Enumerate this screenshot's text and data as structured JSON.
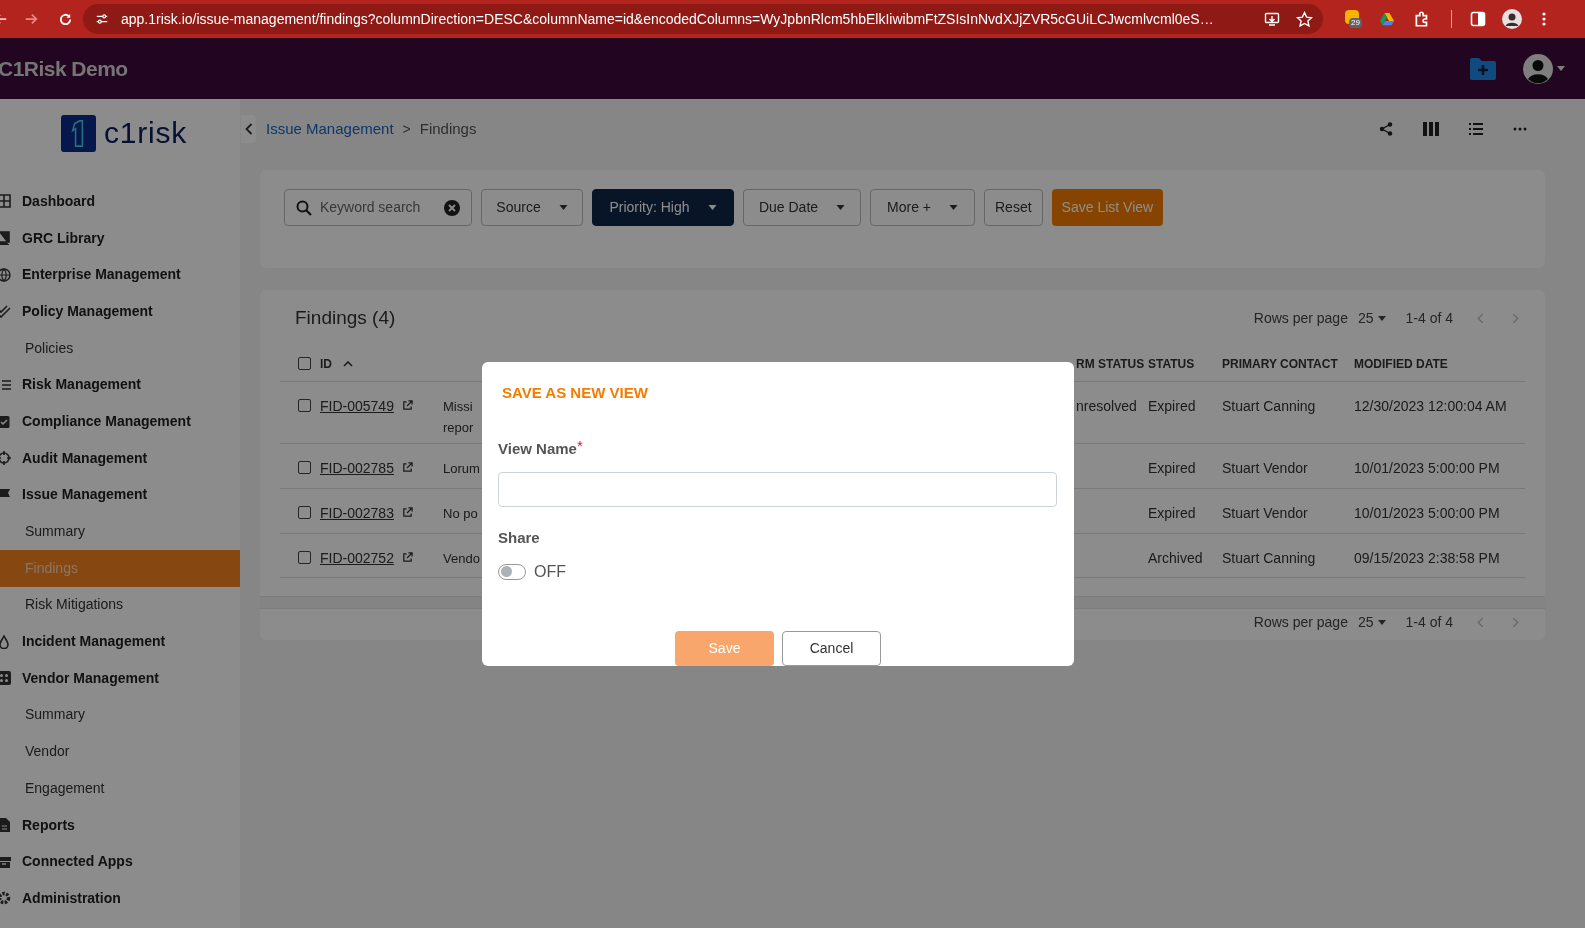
{
  "browser": {
    "url": "app.1risk.io/issue-management/findings?columnDirection=DESC&columnName=id&encodedColumns=WyJpbnRlcm5hbElkIiwibmFtZSIsInNvdXJjZVR5cGUiLCJwcmlvcml0eS…",
    "extension_badge": "29"
  },
  "app_header": {
    "title": "C1Risk Demo"
  },
  "sidebar": {
    "logo_text": "c1risk",
    "items": [
      {
        "label": "Dashboard",
        "kind": "section",
        "selected": false
      },
      {
        "label": "GRC Library",
        "kind": "section",
        "selected": false
      },
      {
        "label": "Enterprise Management",
        "kind": "section",
        "selected": false
      },
      {
        "label": "Policy Management",
        "kind": "section",
        "selected": false
      },
      {
        "label": "Policies",
        "kind": "page",
        "selected": false
      },
      {
        "label": "Risk Management",
        "kind": "section",
        "selected": false
      },
      {
        "label": "Compliance Management",
        "kind": "section",
        "selected": false
      },
      {
        "label": "Audit Management",
        "kind": "section",
        "selected": false
      },
      {
        "label": "Issue Management",
        "kind": "section",
        "selected": false
      },
      {
        "label": "Summary",
        "kind": "page",
        "selected": false
      },
      {
        "label": "Findings",
        "kind": "page",
        "selected": true
      },
      {
        "label": "Risk Mitigations",
        "kind": "page",
        "selected": false
      },
      {
        "label": "Incident Management",
        "kind": "section",
        "selected": false
      },
      {
        "label": "Vendor Management",
        "kind": "section",
        "selected": false
      },
      {
        "label": "Summary",
        "kind": "page",
        "selected": false
      },
      {
        "label": "Vendor",
        "kind": "page",
        "selected": false
      },
      {
        "label": "Engagement",
        "kind": "page",
        "selected": false
      },
      {
        "label": "Reports",
        "kind": "section",
        "selected": false
      },
      {
        "label": "Connected Apps",
        "kind": "section",
        "selected": false
      },
      {
        "label": "Administration",
        "kind": "section",
        "selected": false
      }
    ]
  },
  "breadcrumb": {
    "separator": ">",
    "items": [
      {
        "label": "Issue Management",
        "kind": "link"
      },
      {
        "label": "Findings",
        "kind": "current"
      }
    ]
  },
  "filters": {
    "search": {
      "placeholder": "Keyword search"
    },
    "dropdowns": [
      {
        "label": "Source",
        "active": false
      },
      {
        "label": "Priority: High",
        "active": true
      },
      {
        "label": "Due Date",
        "active": false
      },
      {
        "label": "More +",
        "active": false
      }
    ],
    "reset": "Reset",
    "save_view": "Save List View"
  },
  "findings": {
    "title": "Findings (4)",
    "pagination_top": {
      "rows_label": "Rows per page",
      "rows": "25",
      "range": "1-4 of 4"
    },
    "header_checked": false,
    "columns": [
      {
        "label": "ID",
        "sorted": true
      },
      {
        "label": "RM STATUS"
      },
      {
        "label": "STATUS"
      },
      {
        "label": "PRIMARY CONTACT"
      },
      {
        "label": "MODIFIED DATE"
      }
    ],
    "rows": [
      {
        "checked": false,
        "id": "FID-005749",
        "finding_name": [
          "Missi",
          "repor"
        ],
        "rm_status": "nresolved",
        "status": "Expired",
        "primary_contact": "Stuart Canning",
        "modified_date": "12/30/2023 12:00:04 AM"
      },
      {
        "checked": false,
        "id": "FID-002785",
        "finding_name": [
          "Lorum"
        ],
        "status": "Expired",
        "primary_contact": "Stuart Vendor",
        "modified_date": "10/01/2023 5:00:00 PM"
      },
      {
        "checked": false,
        "id": "FID-002783",
        "finding_name": [
          "No po"
        ],
        "status": "Expired",
        "primary_contact": "Stuart Vendor",
        "modified_date": "10/01/2023 5:00:00 PM"
      },
      {
        "checked": false,
        "id": "FID-002752",
        "finding_name": [
          "Vendo"
        ],
        "status": "Archived",
        "primary_contact": "Stuart Canning",
        "modified_date": "09/15/2023 2:38:58 PM"
      }
    ],
    "pagination_bottom": {
      "rows_label": "Rows per page",
      "rows": "25",
      "range": "1-4 of 4"
    }
  },
  "modal": {
    "title": "SAVE AS NEW VIEW",
    "view_name": {
      "label": "View Name",
      "required_mark": "*"
    },
    "share": {
      "label": "Share",
      "on": false,
      "state_text": "OFF"
    },
    "buttons": [
      {
        "label": "Save",
        "kind": "primary",
        "disabled": true
      },
      {
        "label": "Cancel",
        "kind": "secondary",
        "disabled": false
      }
    ]
  }
}
